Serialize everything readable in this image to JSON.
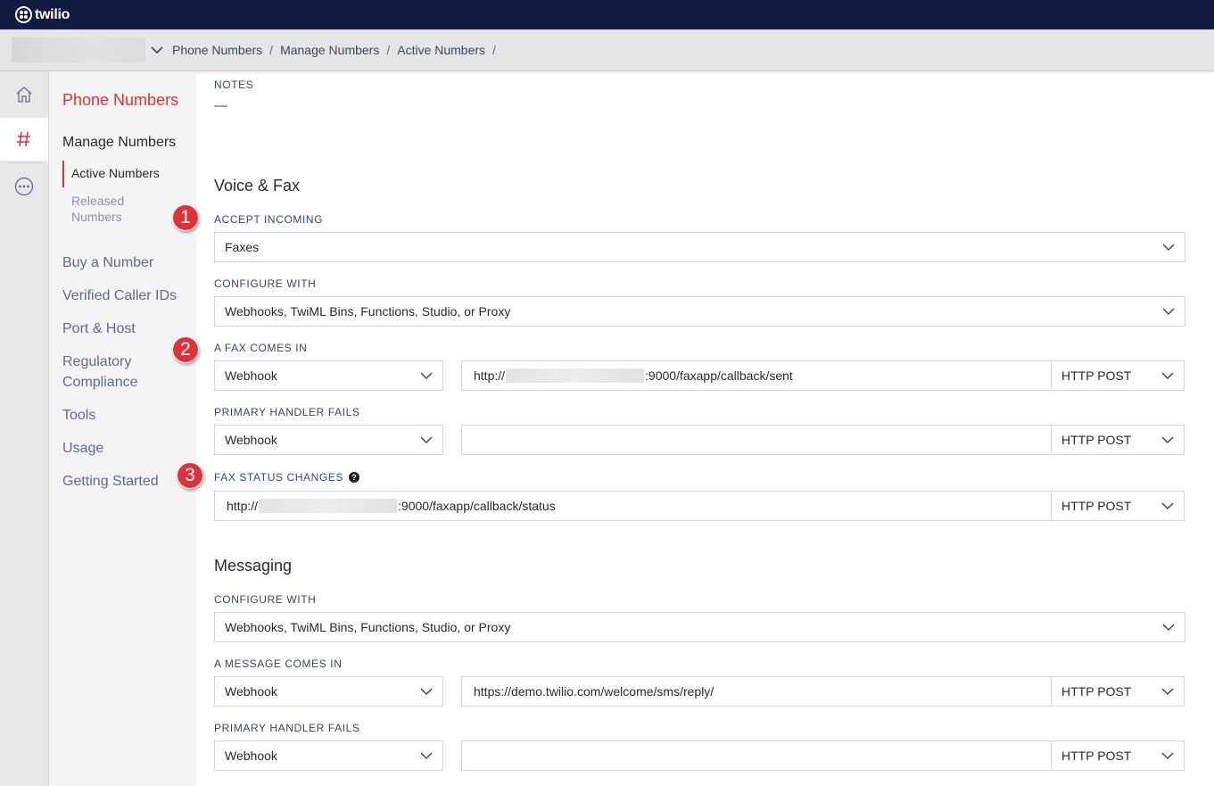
{
  "brand": {
    "name": "twilio"
  },
  "breadcrumb": [
    "Phone Numbers",
    "Manage Numbers",
    "Active Numbers"
  ],
  "breadcrumb_sep": "/",
  "subnav": {
    "title": "Phone Numbers",
    "group": "Manage Numbers",
    "active_item": "Active Numbers",
    "released_item": "Released Numbers",
    "items": [
      "Buy a Number",
      "Verified Caller IDs",
      "Port & Host",
      "Regulatory Compliance",
      "Tools",
      "Usage",
      "Getting Started"
    ]
  },
  "notes": {
    "label": "NOTES",
    "value": "—"
  },
  "voice_fax": {
    "title": "Voice & Fax",
    "accept_incoming_label": "ACCEPT INCOMING",
    "accept_incoming_value": "Faxes",
    "configure_with_label": "CONFIGURE WITH",
    "configure_with_value": "Webhooks, TwiML Bins, Functions, Studio, or Proxy",
    "fax_comes_in_label": "A FAX COMES IN",
    "fax_comes_in_type": "Webhook",
    "fax_comes_in_url_prefix": "http://",
    "fax_comes_in_url_suffix": ":9000/faxapp/callback/sent",
    "fax_comes_in_method": "HTTP POST",
    "primary_fails_label": "PRIMARY HANDLER FAILS",
    "primary_fails_type": "Webhook",
    "primary_fails_url": "",
    "primary_fails_method": "HTTP POST",
    "status_changes_label": "FAX STATUS CHANGES",
    "status_url_prefix": "http://",
    "status_url_suffix": ":9000/faxapp/callback/status",
    "status_method": "HTTP POST"
  },
  "messaging": {
    "title": "Messaging",
    "configure_with_label": "CONFIGURE WITH",
    "configure_with_value": "Webhooks, TwiML Bins, Functions, Studio, or Proxy",
    "message_comes_in_label": "A MESSAGE COMES IN",
    "message_comes_in_type": "Webhook",
    "message_comes_in_url": "https://demo.twilio.com/welcome/sms/reply/",
    "message_comes_in_method": "HTTP POST",
    "primary_fails_label": "PRIMARY HANDLER FAILS",
    "primary_fails_type": "Webhook",
    "primary_fails_url": "",
    "primary_fails_method": "HTTP POST"
  },
  "callouts": [
    "1",
    "2",
    "3"
  ],
  "help_glyph": "?",
  "icons": [
    "home-icon",
    "hash-icon",
    "more-icon",
    "chevron-down-icon"
  ],
  "colors": {
    "topbar": "#121c42",
    "accent": "#e0313a",
    "badge": "#e0313a"
  }
}
